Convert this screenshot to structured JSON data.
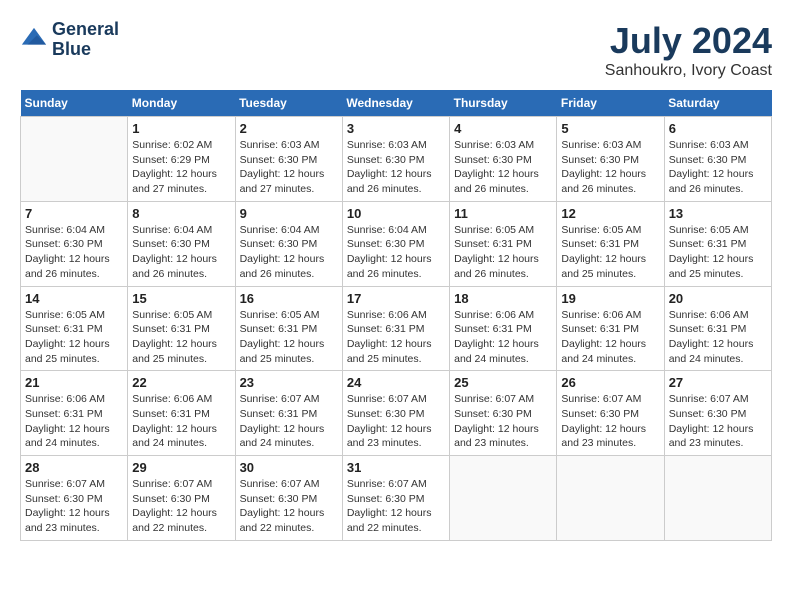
{
  "header": {
    "logo_line1": "General",
    "logo_line2": "Blue",
    "title": "July 2024",
    "subtitle": "Sanhoukro, Ivory Coast"
  },
  "calendar": {
    "days_of_week": [
      "Sunday",
      "Monday",
      "Tuesday",
      "Wednesday",
      "Thursday",
      "Friday",
      "Saturday"
    ],
    "weeks": [
      [
        {
          "day": "",
          "info": ""
        },
        {
          "day": "1",
          "info": "Sunrise: 6:02 AM\nSunset: 6:29 PM\nDaylight: 12 hours\nand 27 minutes."
        },
        {
          "day": "2",
          "info": "Sunrise: 6:03 AM\nSunset: 6:30 PM\nDaylight: 12 hours\nand 27 minutes."
        },
        {
          "day": "3",
          "info": "Sunrise: 6:03 AM\nSunset: 6:30 PM\nDaylight: 12 hours\nand 26 minutes."
        },
        {
          "day": "4",
          "info": "Sunrise: 6:03 AM\nSunset: 6:30 PM\nDaylight: 12 hours\nand 26 minutes."
        },
        {
          "day": "5",
          "info": "Sunrise: 6:03 AM\nSunset: 6:30 PM\nDaylight: 12 hours\nand 26 minutes."
        },
        {
          "day": "6",
          "info": "Sunrise: 6:03 AM\nSunset: 6:30 PM\nDaylight: 12 hours\nand 26 minutes."
        }
      ],
      [
        {
          "day": "7",
          "info": "Sunrise: 6:04 AM\nSunset: 6:30 PM\nDaylight: 12 hours\nand 26 minutes."
        },
        {
          "day": "8",
          "info": "Sunrise: 6:04 AM\nSunset: 6:30 PM\nDaylight: 12 hours\nand 26 minutes."
        },
        {
          "day": "9",
          "info": "Sunrise: 6:04 AM\nSunset: 6:30 PM\nDaylight: 12 hours\nand 26 minutes."
        },
        {
          "day": "10",
          "info": "Sunrise: 6:04 AM\nSunset: 6:30 PM\nDaylight: 12 hours\nand 26 minutes."
        },
        {
          "day": "11",
          "info": "Sunrise: 6:05 AM\nSunset: 6:31 PM\nDaylight: 12 hours\nand 26 minutes."
        },
        {
          "day": "12",
          "info": "Sunrise: 6:05 AM\nSunset: 6:31 PM\nDaylight: 12 hours\nand 25 minutes."
        },
        {
          "day": "13",
          "info": "Sunrise: 6:05 AM\nSunset: 6:31 PM\nDaylight: 12 hours\nand 25 minutes."
        }
      ],
      [
        {
          "day": "14",
          "info": "Sunrise: 6:05 AM\nSunset: 6:31 PM\nDaylight: 12 hours\nand 25 minutes."
        },
        {
          "day": "15",
          "info": "Sunrise: 6:05 AM\nSunset: 6:31 PM\nDaylight: 12 hours\nand 25 minutes."
        },
        {
          "day": "16",
          "info": "Sunrise: 6:05 AM\nSunset: 6:31 PM\nDaylight: 12 hours\nand 25 minutes."
        },
        {
          "day": "17",
          "info": "Sunrise: 6:06 AM\nSunset: 6:31 PM\nDaylight: 12 hours\nand 25 minutes."
        },
        {
          "day": "18",
          "info": "Sunrise: 6:06 AM\nSunset: 6:31 PM\nDaylight: 12 hours\nand 24 minutes."
        },
        {
          "day": "19",
          "info": "Sunrise: 6:06 AM\nSunset: 6:31 PM\nDaylight: 12 hours\nand 24 minutes."
        },
        {
          "day": "20",
          "info": "Sunrise: 6:06 AM\nSunset: 6:31 PM\nDaylight: 12 hours\nand 24 minutes."
        }
      ],
      [
        {
          "day": "21",
          "info": "Sunrise: 6:06 AM\nSunset: 6:31 PM\nDaylight: 12 hours\nand 24 minutes."
        },
        {
          "day": "22",
          "info": "Sunrise: 6:06 AM\nSunset: 6:31 PM\nDaylight: 12 hours\nand 24 minutes."
        },
        {
          "day": "23",
          "info": "Sunrise: 6:07 AM\nSunset: 6:31 PM\nDaylight: 12 hours\nand 24 minutes."
        },
        {
          "day": "24",
          "info": "Sunrise: 6:07 AM\nSunset: 6:30 PM\nDaylight: 12 hours\nand 23 minutes."
        },
        {
          "day": "25",
          "info": "Sunrise: 6:07 AM\nSunset: 6:30 PM\nDaylight: 12 hours\nand 23 minutes."
        },
        {
          "day": "26",
          "info": "Sunrise: 6:07 AM\nSunset: 6:30 PM\nDaylight: 12 hours\nand 23 minutes."
        },
        {
          "day": "27",
          "info": "Sunrise: 6:07 AM\nSunset: 6:30 PM\nDaylight: 12 hours\nand 23 minutes."
        }
      ],
      [
        {
          "day": "28",
          "info": "Sunrise: 6:07 AM\nSunset: 6:30 PM\nDaylight: 12 hours\nand 23 minutes."
        },
        {
          "day": "29",
          "info": "Sunrise: 6:07 AM\nSunset: 6:30 PM\nDaylight: 12 hours\nand 22 minutes."
        },
        {
          "day": "30",
          "info": "Sunrise: 6:07 AM\nSunset: 6:30 PM\nDaylight: 12 hours\nand 22 minutes."
        },
        {
          "day": "31",
          "info": "Sunrise: 6:07 AM\nSunset: 6:30 PM\nDaylight: 12 hours\nand 22 minutes."
        },
        {
          "day": "",
          "info": ""
        },
        {
          "day": "",
          "info": ""
        },
        {
          "day": "",
          "info": ""
        }
      ]
    ]
  }
}
